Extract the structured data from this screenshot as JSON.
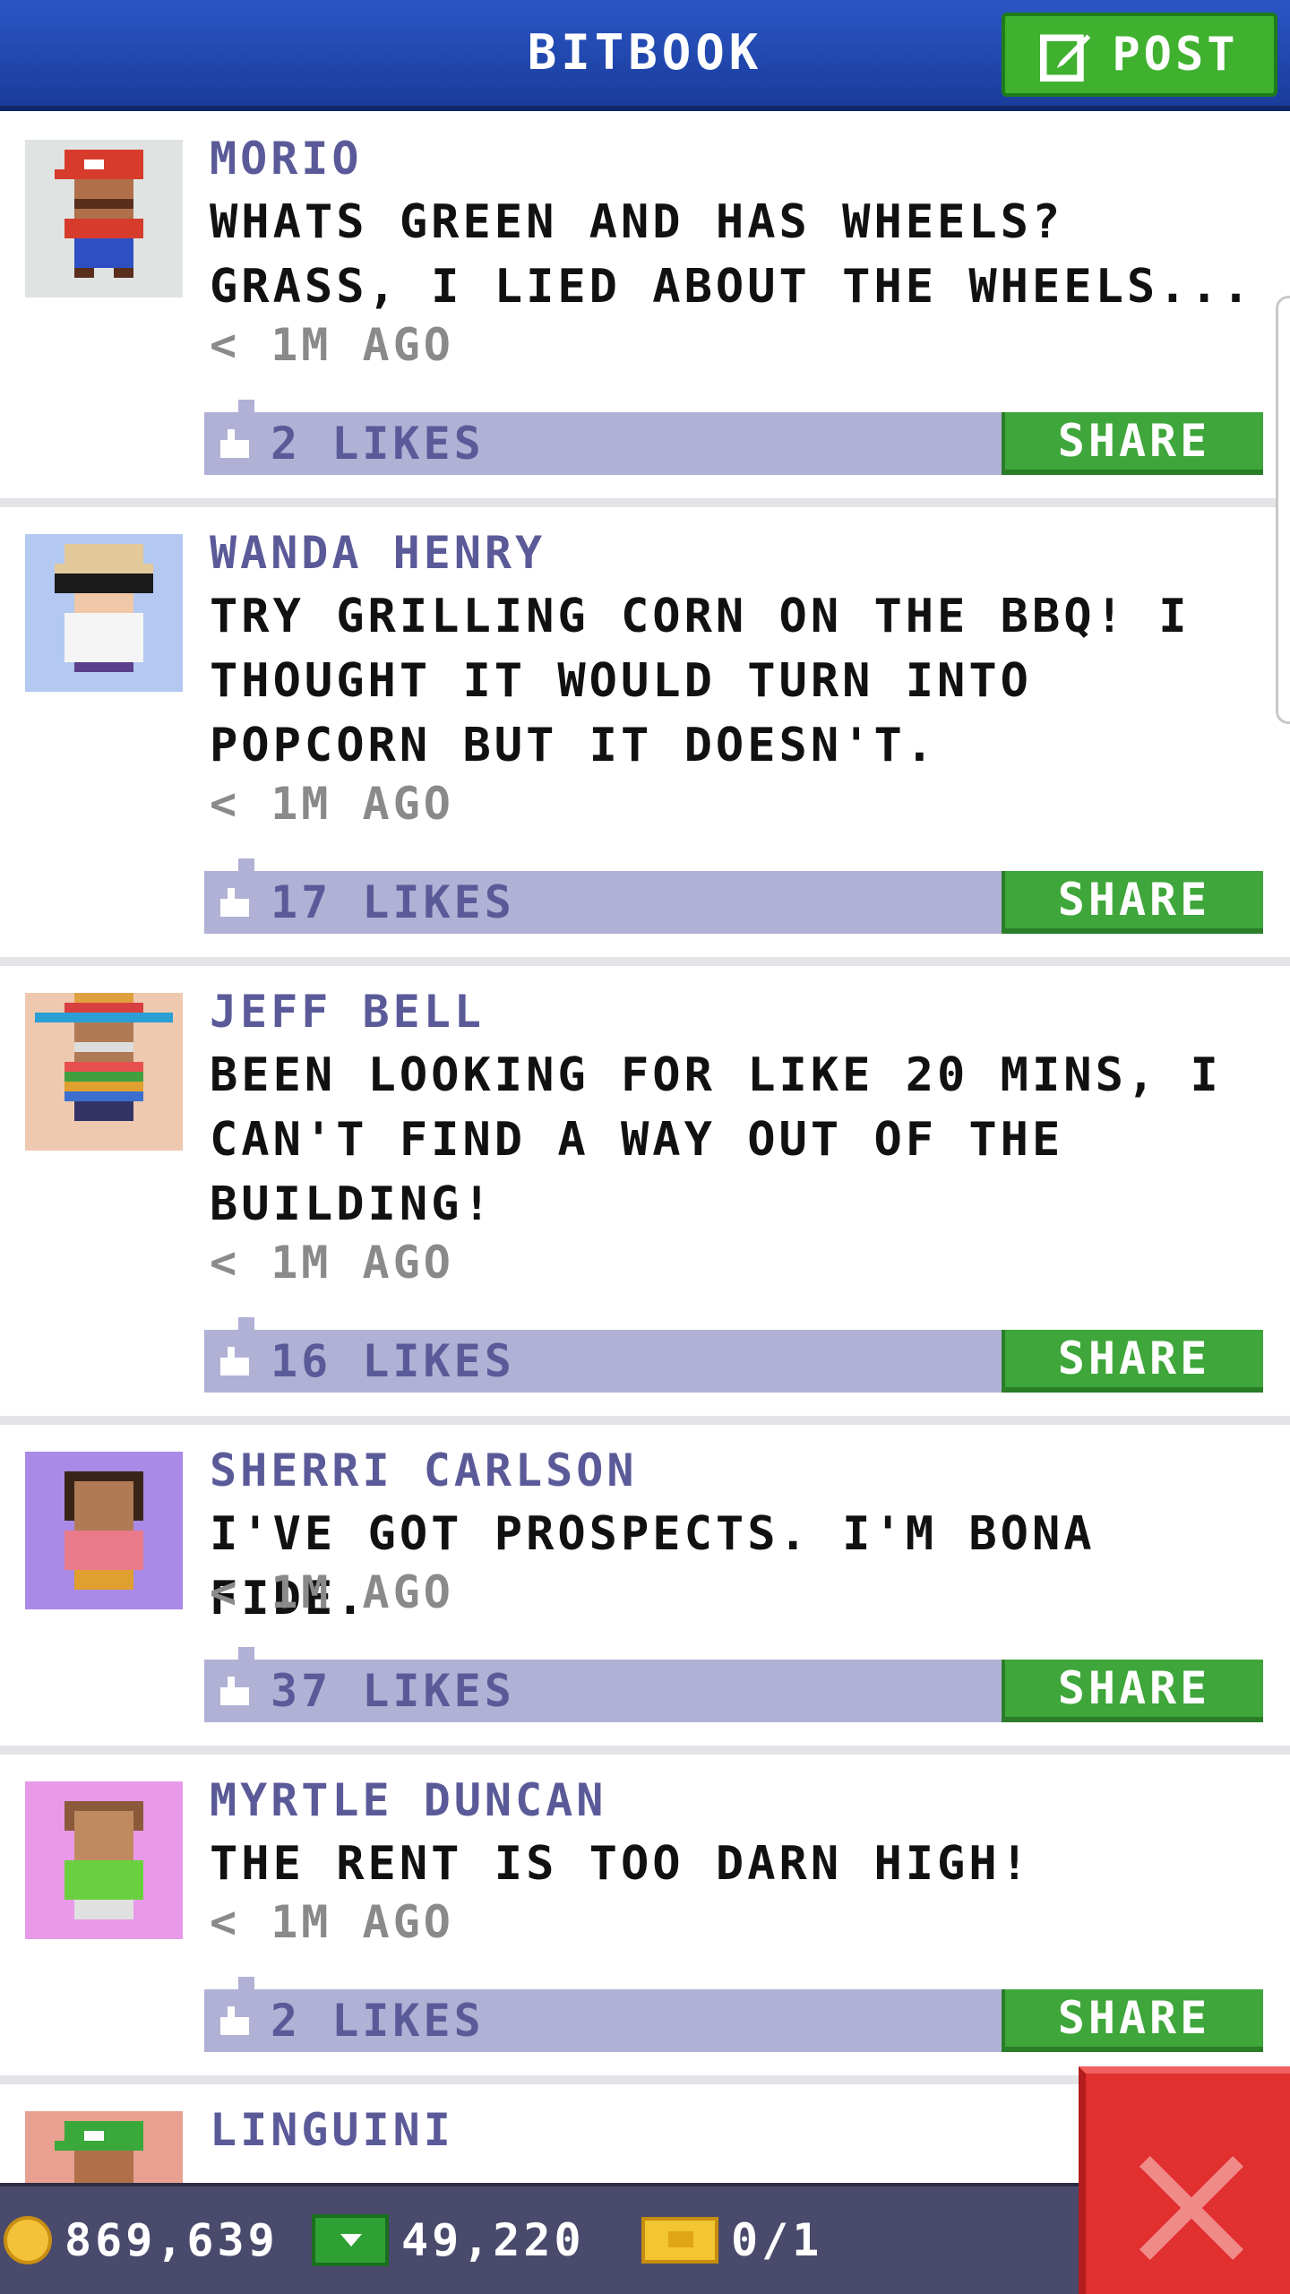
{
  "header": {
    "title": "BITBOOK",
    "post_label": "POST"
  },
  "posts": [
    {
      "name": "MORIO",
      "lines": [
        "WHATS GREEN AND HAS WHEELS?",
        "GRASS, I LIED ABOUT THE WHEELS..."
      ],
      "time": "< 1M AGO",
      "likes": "2 LIKES",
      "share": "SHARE"
    },
    {
      "name": "WANDA HENRY",
      "lines": [
        "TRY GRILLING CORN ON THE BBQ! I",
        "THOUGHT IT WOULD TURN INTO",
        "POPCORN BUT IT DOESN'T."
      ],
      "time": "< 1M AGO",
      "likes": "17 LIKES",
      "share": "SHARE"
    },
    {
      "name": "JEFF BELL",
      "lines": [
        "BEEN LOOKING FOR LIKE 20 MINS, I",
        "CAN'T FIND A WAY OUT OF THE",
        "BUILDING!"
      ],
      "time": "< 1M AGO",
      "likes": "16 LIKES",
      "share": "SHARE"
    },
    {
      "name": "SHERRI CARLSON",
      "lines": [
        "I'VE GOT PROSPECTS. I'M BONA FIDE."
      ],
      "time": "< 1M AGO",
      "likes": "37 LIKES",
      "share": "SHARE"
    },
    {
      "name": "MYRTLE DUNCAN",
      "lines": [
        "THE RENT IS TOO DARN HIGH!"
      ],
      "time": "< 1M AGO",
      "likes": "2 LIKES",
      "share": "SHARE"
    },
    {
      "name": "LINGUINI",
      "lines": [],
      "time": "",
      "likes": "",
      "share": ""
    }
  ],
  "status": {
    "coins": "869,639",
    "bux": "49,220",
    "tickets": "0/1"
  },
  "colors": {
    "header_blue": "#1f47b0",
    "accent_green": "#3ea63a",
    "like_bar": "#b1b1d6",
    "name_purple": "#5b5a99",
    "close_red": "#e0302f"
  }
}
